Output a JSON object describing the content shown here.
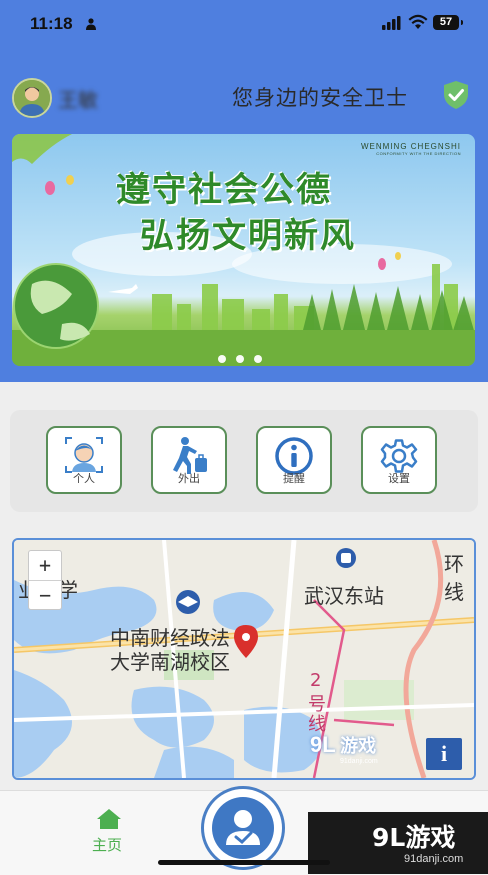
{
  "status_bar": {
    "time": "11:18",
    "battery": "57"
  },
  "header": {
    "username": "王敏",
    "slogan": "您身边的安全卫士"
  },
  "banner": {
    "title_line1": "遵守社会公德",
    "title_line2": "弘扬文明新风",
    "en_title": "WENMING CHEGNSHI",
    "en_sub": "CONFORMITY WITH THE DIRECTION"
  },
  "menu": {
    "items": [
      {
        "label": "个人",
        "icon": "person-face-icon"
      },
      {
        "label": "外出",
        "icon": "walking-luggage-icon"
      },
      {
        "label": "提醒",
        "icon": "info-circle-icon"
      },
      {
        "label": "设置",
        "icon": "gear-icon"
      }
    ]
  },
  "map": {
    "labels": {
      "university_left": "业大学",
      "station": "武汉东站",
      "ring": "环",
      "ring2": "线",
      "campus1": "中南财经政法",
      "campus2": "大学南湖校区",
      "line_num": "2",
      "line_char1": "号",
      "line_char2": "线"
    },
    "zoom_in": "+",
    "zoom_out": "−",
    "info": "i"
  },
  "watermark": {
    "map_text": "游戏",
    "map_url": "91danji.com",
    "corner_big": "9L游戏",
    "corner_small": "91danji.com"
  },
  "tabbar": {
    "home_label": "主页"
  },
  "colors": {
    "header_blue": "#4f7fdf",
    "accent_green": "#4caf50",
    "map_border": "#5a8fd8"
  }
}
